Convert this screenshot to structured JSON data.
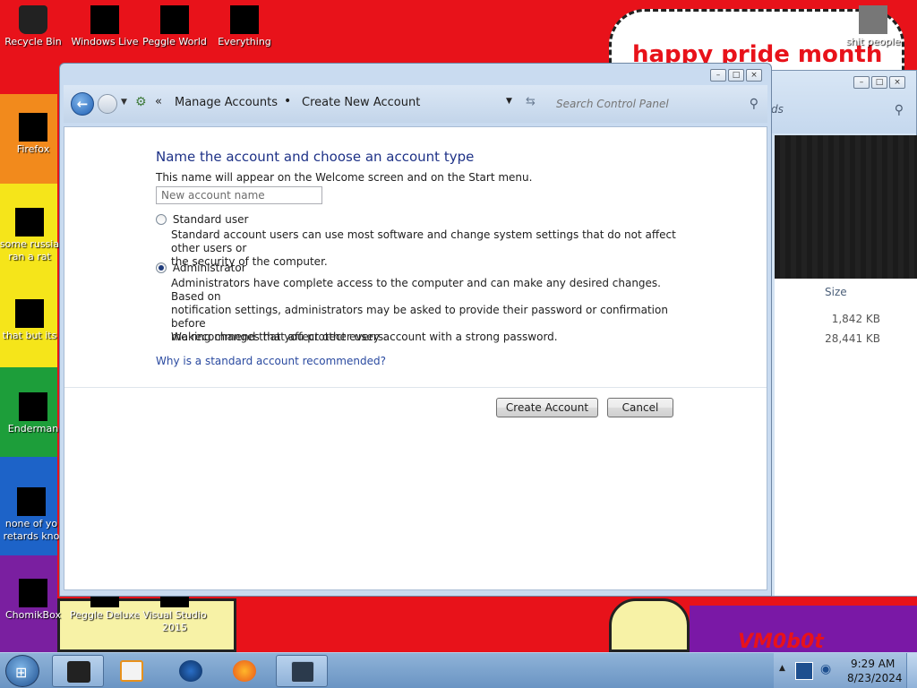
{
  "desktop": {
    "wallpaper_text": "happy pride month",
    "watermark": "VM0b0t",
    "icons": [
      {
        "label": "Recycle Bin"
      },
      {
        "label": "Windows Live"
      },
      {
        "label": "Peggle World"
      },
      {
        "label": "Everything"
      },
      {
        "label": "shit people"
      },
      {
        "label": "Firefox"
      },
      {
        "label": "some russia"
      },
      {
        "label": "ran a rat"
      },
      {
        "label": "that but its"
      },
      {
        "label": "Enderman"
      },
      {
        "label": "none of yo"
      },
      {
        "label": "retards kno"
      },
      {
        "label": "ChomikBox"
      },
      {
        "label": "Peggle Deluxe"
      },
      {
        "label": "Visual Studio"
      },
      {
        "label": "2015"
      }
    ]
  },
  "back_window": {
    "search_tail": "ds",
    "size_header": "Size",
    "sizes": [
      "1,842 KB",
      "28,441 KB"
    ]
  },
  "window": {
    "breadcrumb": [
      "Manage Accounts",
      "Create New Account"
    ],
    "search_placeholder": "Search Control Panel",
    "heading": "Name the account and choose an account type",
    "subtext": "This name will appear on the Welcome screen and on the Start menu.",
    "name_placeholder": "New account name",
    "options": [
      {
        "label": "Standard user",
        "checked": false,
        "desc_lines": [
          "Standard account users can use most software and change system settings that do not affect other users or",
          "the security of the computer."
        ]
      },
      {
        "label": "Administrator",
        "checked": true,
        "desc_lines": [
          "Administrators have complete access to the computer and can make any desired changes. Based on",
          "notification settings, administrators may be asked to provide their password or confirmation before",
          "making changes that affect other users."
        ]
      }
    ],
    "recommend": "We recommend that you protect every account with a strong password.",
    "link": "Why is a standard account recommended?",
    "create_button": "Create Account",
    "cancel_button": "Cancel"
  },
  "taskbar": {
    "time": "9:29 AM",
    "date": "8/23/2024",
    "colors": {
      "bar": "#7ea3cd",
      "accent": "#1e4f8f"
    }
  }
}
